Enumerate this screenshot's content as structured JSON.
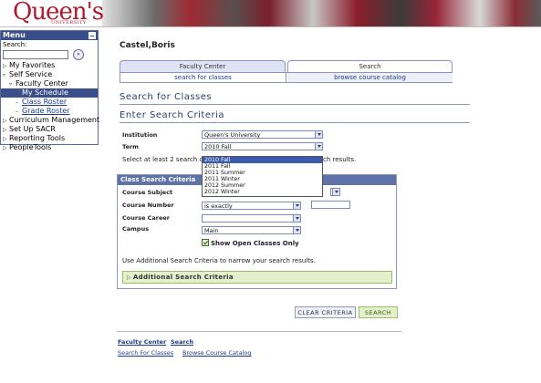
{
  "header": {
    "logo_text": "Queen's",
    "logo_sub": "UNIVERSITY"
  },
  "menu": {
    "title": "Menu",
    "search_label": "Search:",
    "search_value": "",
    "items": [
      {
        "label": "My Favorites",
        "level": 0,
        "expanded": false
      },
      {
        "label": "Self Service",
        "level": 0,
        "expanded": true
      },
      {
        "label": "Faculty Center",
        "level": 1,
        "expanded": true
      },
      {
        "label": "My Schedule",
        "level": 2,
        "active": true
      },
      {
        "label": "Class Roster",
        "level": 2,
        "link": true
      },
      {
        "label": "Grade Roster",
        "level": 2,
        "link": true
      },
      {
        "label": "Curriculum Management",
        "level": 0,
        "expanded": false
      },
      {
        "label": "Set Up SACR",
        "level": 0,
        "expanded": false
      },
      {
        "label": "Reporting Tools",
        "level": 0,
        "expanded": false
      },
      {
        "label": "PeopleTools",
        "level": 0,
        "expanded": false
      }
    ]
  },
  "user": {
    "name": "Castel,Boris"
  },
  "tabs": {
    "faculty_center": "Faculty Center",
    "search": "Search",
    "sub_search": "search for classes",
    "sub_browse": "browse course catalog"
  },
  "page": {
    "title": "Search for Classes",
    "section": "Enter Search Criteria"
  },
  "form": {
    "institution_label": "Institution",
    "institution_value": "Queen's University",
    "term_label": "Term",
    "term_value": "2010 Fall",
    "info_text_start": "Select at least 2 search c",
    "info_text_end": "ch results.",
    "term_options": [
      "2010 Fall",
      "2011 Fall",
      "2011 Summer",
      "2011 Winter",
      "2012 Summer",
      "2012 Winter"
    ],
    "term_selected_index": 0
  },
  "panel": {
    "title": "Class Search Criteria",
    "course_subject_label": "Course Subject",
    "course_subject_value": "",
    "course_number_label": "Course Number",
    "course_number_op": "is exactly",
    "course_number_value": "",
    "course_career_label": "Course Career",
    "course_career_value": "",
    "campus_label": "Campus",
    "campus_value": "Main",
    "show_open_label": "Show Open Classes Only",
    "show_open_checked": true,
    "additional_info": "Use Additional Search Criteria to narrow your search results.",
    "additional_label": "Additional Search Criteria"
  },
  "buttons": {
    "clear": "CLEAR CRITERIA",
    "search": "SEARCH"
  },
  "footer": {
    "faculty_center": "Faculty Center",
    "search": "Search",
    "search_for_classes": "Search For Classes",
    "browse_catalog": "Browse Course Catalog"
  }
}
